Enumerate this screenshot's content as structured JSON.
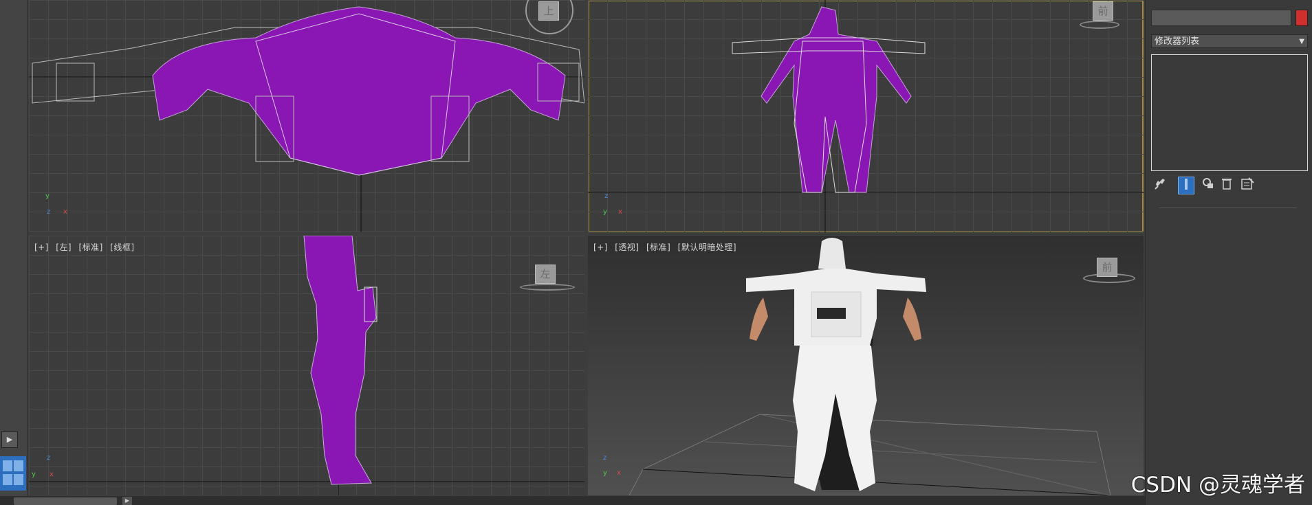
{
  "viewports": {
    "top": {
      "cube_label": "上"
    },
    "front": {
      "cube_label": "前"
    },
    "left": {
      "label": [
        "[+]",
        "[左]",
        "[标准]",
        "[线框]"
      ],
      "cube_label": "左"
    },
    "perspective": {
      "label": [
        "[+]",
        "[透视]",
        "[标准]",
        "[默认明暗处理]"
      ],
      "cube_label": "前"
    }
  },
  "axes": {
    "x": "x",
    "y": "y",
    "z": "z"
  },
  "panel": {
    "modifier_list_label": "修改器列表",
    "dropdown_arrow": "▼",
    "name_value": "",
    "swatch_color": "#d0302d"
  },
  "colors": {
    "accent_active_viewport": "#a58a3a",
    "wire_purple": "#8a17b3"
  },
  "icons": [
    "pin-stack-icon",
    "show-end-result-icon",
    "make-unique-icon",
    "remove-modifier-icon",
    "configure-sets-icon"
  ],
  "watermark": "CSDN @灵魂学者"
}
